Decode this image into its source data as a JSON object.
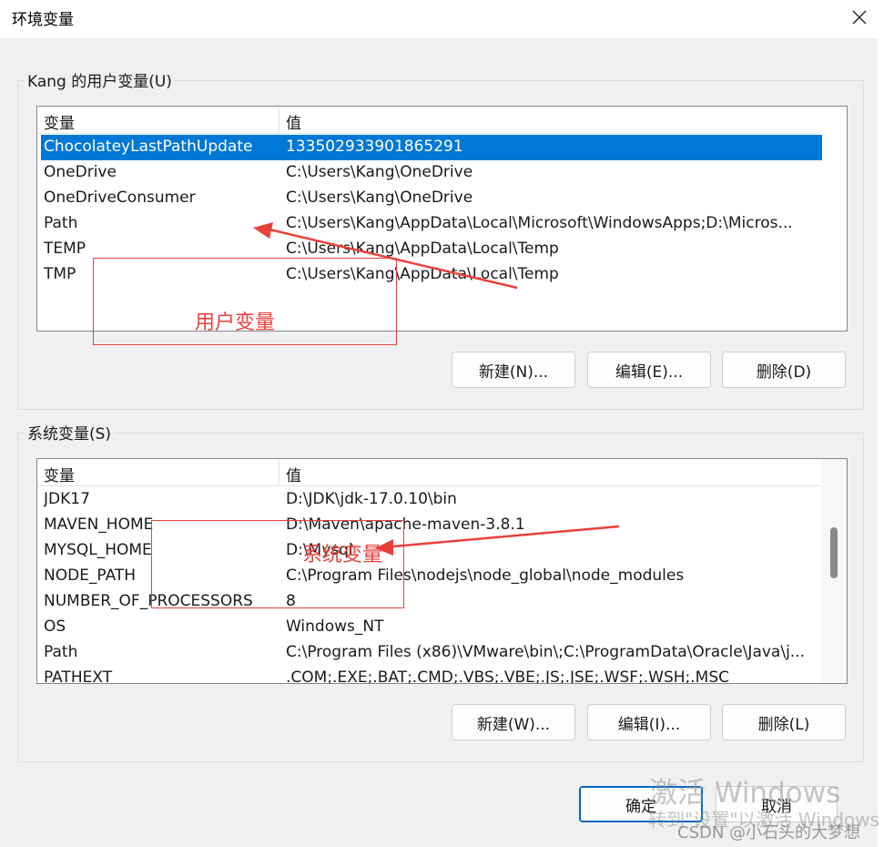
{
  "window": {
    "title": "环境变量",
    "close_icon": "close-icon"
  },
  "user_vars": {
    "legend": "Kang 的用户变量(U)",
    "columns": [
      "变量",
      "值"
    ],
    "rows": [
      {
        "name": "ChocolateyLastPathUpdate",
        "value": "133502933901865291",
        "selected": true
      },
      {
        "name": "OneDrive",
        "value": "C:\\Users\\Kang\\OneDrive"
      },
      {
        "name": "OneDriveConsumer",
        "value": "C:\\Users\\Kang\\OneDrive"
      },
      {
        "name": "Path",
        "value": "C:\\Users\\Kang\\AppData\\Local\\Microsoft\\WindowsApps;D:\\Micros..."
      },
      {
        "name": "TEMP",
        "value": "C:\\Users\\Kang\\AppData\\Local\\Temp"
      },
      {
        "name": "TMP",
        "value": "C:\\Users\\Kang\\AppData\\Local\\Temp"
      }
    ],
    "buttons": {
      "new": "新建(N)...",
      "edit": "编辑(E)...",
      "delete": "删除(D)"
    }
  },
  "system_vars": {
    "legend": "系统变量(S)",
    "columns": [
      "变量",
      "值"
    ],
    "rows": [
      {
        "name": "JDK17",
        "value": "D:\\JDK\\jdk-17.0.10\\bin"
      },
      {
        "name": "MAVEN_HOME",
        "value": "D:\\Maven\\apache-maven-3.8.1"
      },
      {
        "name": "MYSQL_HOME",
        "value": "D:\\Mysql"
      },
      {
        "name": "NODE_PATH",
        "value": "C:\\Program Files\\nodejs\\node_global\\node_modules"
      },
      {
        "name": "NUMBER_OF_PROCESSORS",
        "value": "8"
      },
      {
        "name": "OS",
        "value": "Windows_NT"
      },
      {
        "name": "Path",
        "value": "C:\\Program Files (x86)\\VMware\\bin\\;C:\\ProgramData\\Oracle\\Java\\j..."
      },
      {
        "name": "PATHEXT",
        "value": ".COM;.EXE;.BAT;.CMD;.VBS;.VBE;.JS;.JSE;.WSF;.WSH;.MSC"
      }
    ],
    "buttons": {
      "new": "新建(W)...",
      "edit": "编辑(I)...",
      "delete": "删除(L)"
    }
  },
  "dialog_buttons": {
    "ok": "确定",
    "cancel": "取消"
  },
  "annotations": {
    "user": "用户变量",
    "system": "系统变量",
    "color": "#e8413a"
  },
  "watermarks": {
    "activate_title": "激活 Windows",
    "activate_sub": "转到\"设置\"以激活 Windows",
    "csdn": "CSDN @小石头的大梦想"
  }
}
